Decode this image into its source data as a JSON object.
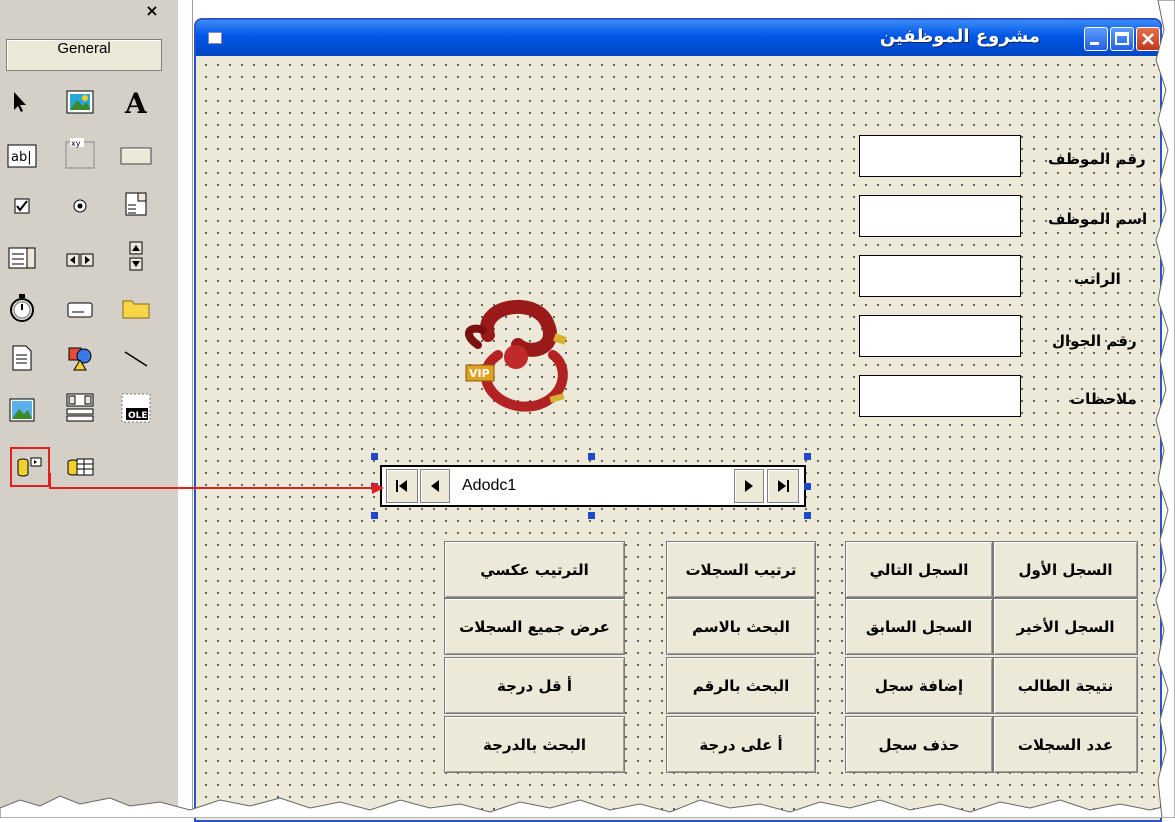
{
  "toolbox": {
    "close_label": "×",
    "tab_label": "General",
    "tools": [
      {
        "name": "pointer-icon"
      },
      {
        "name": "picturebox-icon"
      },
      {
        "name": "label-icon"
      },
      {
        "name": "textbox-icon"
      },
      {
        "name": "frame-icon"
      },
      {
        "name": "commandbutton-icon"
      },
      {
        "name": "checkbox-icon"
      },
      {
        "name": "optionbutton-icon"
      },
      {
        "name": "combobox-icon"
      },
      {
        "name": "listbox-icon"
      },
      {
        "name": "hscrollbar-icon"
      },
      {
        "name": "vscrollbar-icon"
      },
      {
        "name": "timer-icon"
      },
      {
        "name": "drivelistbox-icon"
      },
      {
        "name": "dirlistbox-icon"
      },
      {
        "name": "filelistbox-icon"
      },
      {
        "name": "shape-icon"
      },
      {
        "name": "line-icon"
      },
      {
        "name": "image-icon"
      },
      {
        "name": "data-icon"
      },
      {
        "name": "ole-icon"
      },
      {
        "name": "adodc-icon"
      },
      {
        "name": "datagrid-icon"
      }
    ],
    "textbox_glyph": "ab|",
    "frame_glyph": "xy",
    "ole_glyph": "OLE",
    "highlight_color": "#e02020"
  },
  "form": {
    "title": "مشروع الموظفين",
    "fields": [
      {
        "label": "رقم الموظف"
      },
      {
        "label": "اسم الموظف"
      },
      {
        "label": "الراتب"
      },
      {
        "label": "رقم الجوال"
      },
      {
        "label": "ملاحظات"
      }
    ],
    "logo_badge": "VIP",
    "ado_control": {
      "caption": "Adodc1"
    },
    "buttons": {
      "first_record": "السجل الأول",
      "next_record": "السجل التالي",
      "sort_records": "ترتيب السجلات",
      "reverse_sort": "الترتيب عكسي",
      "last_record": "السجل الأخير",
      "prev_record": "السجل السابق",
      "search_by_name": "البحث بالاسم",
      "show_all_records": "عرض جميع السجلات",
      "student_result": "نتيجة الطالب",
      "add_record": "إضافة سجل",
      "search_by_number": "البحث بالرقم",
      "lowest_grade": "أ قل درجة",
      "records_count": "عدد السجلات",
      "delete_record": "حذف سجل",
      "highest_grade": "أ على درجة",
      "search_by_grade": "البحث بالدرجة"
    }
  },
  "colors": {
    "title_bar": "#0055e5",
    "form_background": "#ece9d8",
    "selection_handle": "#1f47c9",
    "arrow": "#e02020"
  }
}
